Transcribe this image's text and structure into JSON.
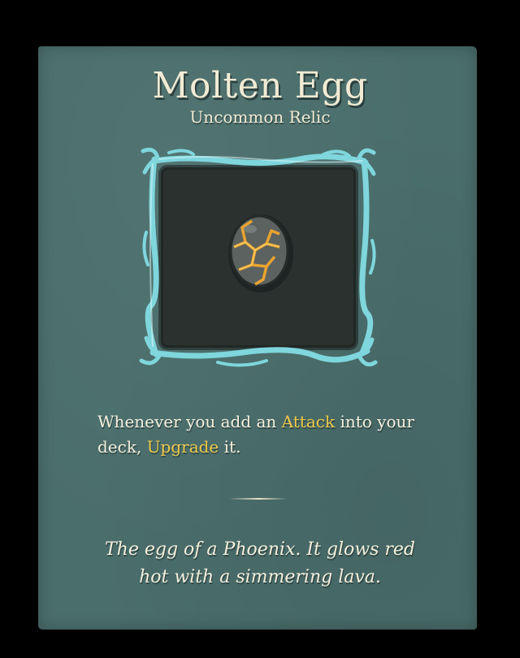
{
  "relic": {
    "name": "Molten Egg",
    "rarity": "Uncommon Relic",
    "icon": "molten-egg-icon",
    "description": {
      "part1": "Whenever you add an ",
      "keyword1": "Attack",
      "part2": " into your deck, ",
      "keyword2": "Upgrade",
      "part3": " it."
    },
    "flavor": {
      "line1": "The egg of a Phoenix. It glows red",
      "line2": "hot with a simmering lava."
    }
  },
  "colors": {
    "background": "#000000",
    "panel": "#4a6e6c",
    "frame": "#7fd6dd",
    "keyword": "#f0c94a",
    "text": "#f4efdc",
    "lava": "#e8a330"
  }
}
